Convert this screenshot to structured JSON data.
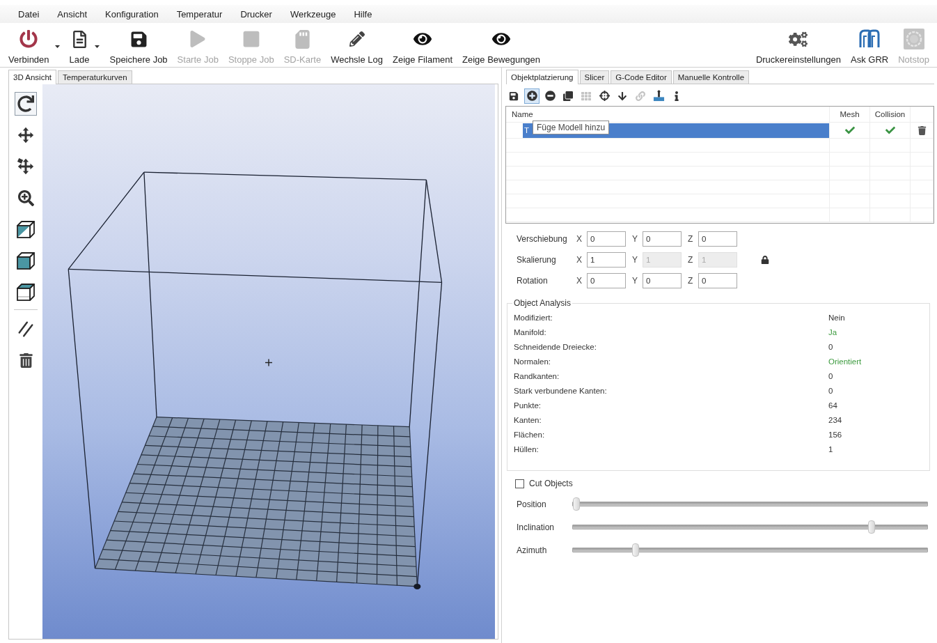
{
  "menu": [
    "Datei",
    "Ansicht",
    "Konfiguration",
    "Temperatur",
    "Drucker",
    "Werkzeuge",
    "Hilfe"
  ],
  "toolbar": {
    "left": [
      {
        "kind": "connect",
        "label": "Verbinden",
        "disabled": false,
        "dropdown": true
      },
      {
        "kind": "load",
        "label": "Lade",
        "disabled": false,
        "dropdown": true
      },
      {
        "kind": "save",
        "label": "Speichere Job",
        "disabled": false,
        "dropdown": false
      },
      {
        "kind": "start",
        "label": "Starte Job",
        "disabled": true,
        "dropdown": false
      },
      {
        "kind": "stop",
        "label": "Stoppe Job",
        "disabled": true,
        "dropdown": false
      },
      {
        "kind": "sd_card",
        "label": "SD-Karte",
        "disabled": true,
        "dropdown": false
      },
      {
        "kind": "log",
        "label": "Wechsle Log",
        "disabled": false,
        "dropdown": false
      },
      {
        "kind": "filament",
        "label": "Zeige Filament",
        "disabled": false,
        "dropdown": false
      },
      {
        "kind": "moves",
        "label": "Zeige Bewegungen",
        "disabled": false,
        "dropdown": false
      }
    ],
    "right": [
      {
        "kind": "printer_settings",
        "label": "Druckereinstellungen",
        "disabled": false,
        "dropdown": false
      },
      {
        "kind": "help",
        "label": "Ask GRR",
        "disabled": false,
        "dropdown": false
      },
      {
        "kind": "emergency_stop",
        "label": "Notstop",
        "disabled": true,
        "dropdown": false
      }
    ]
  },
  "view_tabs": [
    {
      "label": "3D Ansicht",
      "selected": true
    },
    {
      "label": "Temperaturkurven",
      "selected": false
    }
  ],
  "view_tool_groups": [
    {
      "tools": [
        {
          "kind": "rotate",
          "selected": true
        },
        {
          "kind": "move_view",
          "selected": false
        },
        {
          "kind": "move_object",
          "selected": false
        },
        {
          "kind": "zoom",
          "selected": false
        },
        {
          "kind": "view_front",
          "selected": false
        },
        {
          "kind": "view_solid",
          "selected": false
        },
        {
          "kind": "view_top",
          "selected": false
        }
      ]
    },
    {
      "tools": [
        {
          "kind": "parallel",
          "selected": false
        },
        {
          "kind": "delete",
          "selected": false
        }
      ]
    }
  ],
  "panel_tabs": [
    {
      "label": "Objektplatzierung",
      "selected": true
    },
    {
      "label": "Slicer",
      "selected": false
    },
    {
      "label": "G-Code Editor",
      "selected": false
    },
    {
      "label": "Manuelle Kontrolle",
      "selected": false
    }
  ],
  "object_tools": [
    {
      "kind": "save",
      "selected": false,
      "disabled": false
    },
    {
      "kind": "add",
      "selected": true,
      "disabled": false
    },
    {
      "kind": "remove",
      "selected": false,
      "disabled": false
    },
    {
      "kind": "copy",
      "selected": false,
      "disabled": false
    },
    {
      "kind": "arrange",
      "selected": false,
      "disabled": true
    },
    {
      "kind": "center",
      "selected": false,
      "disabled": false
    },
    {
      "kind": "drop",
      "selected": false,
      "disabled": false
    },
    {
      "kind": "link",
      "selected": false,
      "disabled": true
    },
    {
      "kind": "land",
      "selected": false,
      "disabled": false
    },
    {
      "kind": "info",
      "selected": false,
      "disabled": false
    }
  ],
  "tooltip": "Füge Modell hinzu",
  "object_table": {
    "columns": [
      "Name",
      "Mesh",
      "Collision"
    ],
    "rows": [
      {
        "name": "T",
        "selected": true,
        "mesh": true,
        "collision": true
      }
    ]
  },
  "transforms": [
    {
      "label": "Verschiebung",
      "fields": [
        {
          "axis": "X",
          "value": "0",
          "disabled": false
        },
        {
          "axis": "Y",
          "value": "0",
          "disabled": false
        },
        {
          "axis": "Z",
          "value": "0",
          "disabled": false
        }
      ]
    },
    {
      "label": "Skalierung",
      "locked": true,
      "fields": [
        {
          "axis": "X",
          "value": "1",
          "disabled": false
        },
        {
          "axis": "Y",
          "value": "1",
          "disabled": true
        },
        {
          "axis": "Z",
          "value": "1",
          "disabled": true
        }
      ]
    },
    {
      "label": "Rotation",
      "fields": [
        {
          "axis": "X",
          "value": "0",
          "disabled": false
        },
        {
          "axis": "Y",
          "value": "0",
          "disabled": false
        },
        {
          "axis": "Z",
          "value": "0",
          "disabled": false
        }
      ]
    }
  ],
  "object_analysis": {
    "title": "Object Analysis",
    "rows": [
      {
        "label": "Modifiziert:",
        "value": "Nein",
        "ok": false
      },
      {
        "label": "Manifold:",
        "value": "Ja",
        "ok": true
      },
      {
        "label": "Schneidende Dreiecke:",
        "value": "0",
        "ok": false
      },
      {
        "label": "Normalen:",
        "value": "Orientiert",
        "ok": true
      },
      {
        "label": "Randkanten:",
        "value": "0",
        "ok": false
      },
      {
        "label": "Stark verbundene Kanten:",
        "value": "0",
        "ok": false
      },
      {
        "label": "Punkte:",
        "value": "64",
        "ok": false
      },
      {
        "label": "Kanten:",
        "value": "234",
        "ok": false
      },
      {
        "label": "Flächen:",
        "value": "156",
        "ok": false
      },
      {
        "label": "Hüllen:",
        "value": "1",
        "ok": false
      }
    ]
  },
  "cut_objects": {
    "label": "Cut Objects",
    "checked": false
  },
  "sliders": [
    {
      "label": "Position",
      "level": 0
    },
    {
      "label": "Inclination",
      "level": 0.85
    },
    {
      "label": "Azimuth",
      "level": 0.17
    }
  ]
}
